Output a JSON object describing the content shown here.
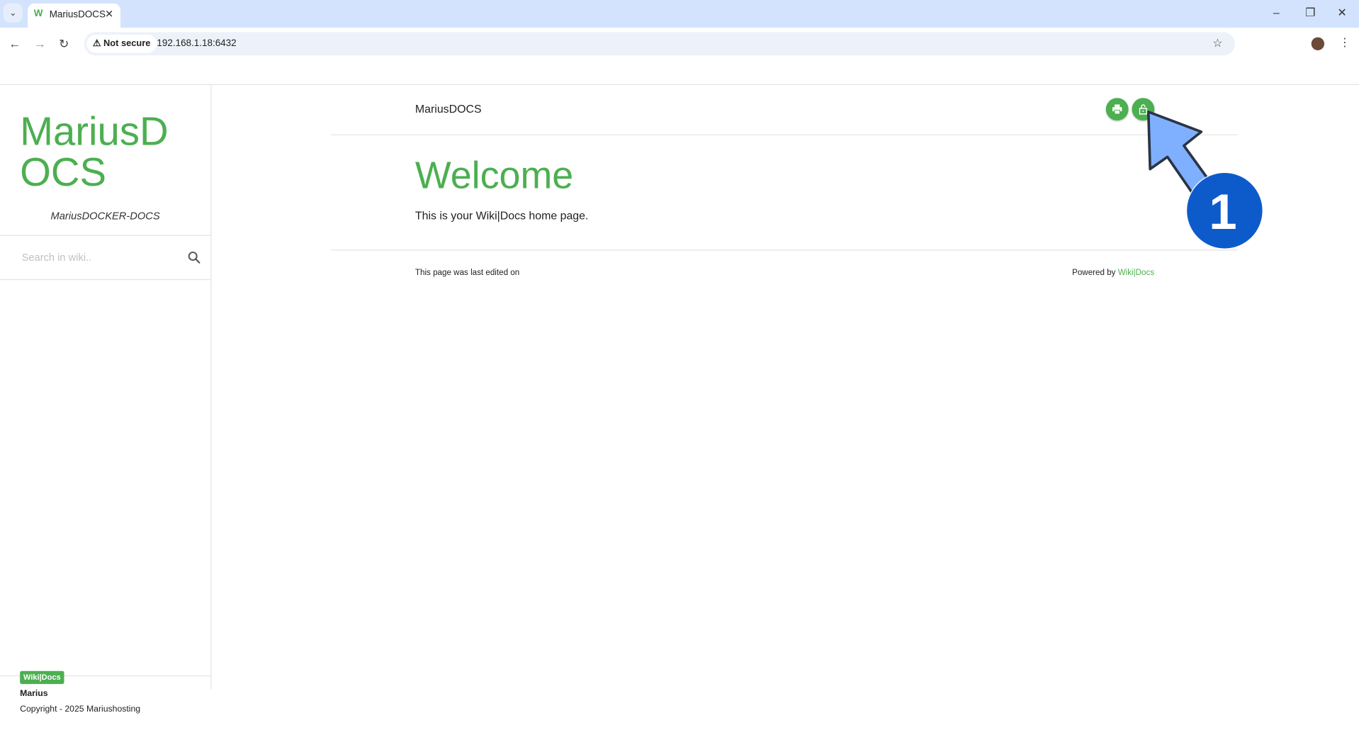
{
  "browser": {
    "tab_title": "MariusDOCS",
    "tab_favicon": "W",
    "security_label": "Not secure",
    "url": "192.168.1.18:6432"
  },
  "sidebar": {
    "brand": "MariusDOCS",
    "subtitle": "MariusDOCKER-DOCS",
    "search_placeholder": "Search in wiki..",
    "footer_badge": "Wiki|Docs",
    "footer_name": "Marius",
    "footer_copyright": "Copyright - 2025 Mariushosting"
  },
  "main": {
    "header_title": "MariusDOCS",
    "heading": "Welcome",
    "body": "This is your Wiki|Docs home page.",
    "last_edited": "This page was last edited on",
    "powered_by": "Powered by",
    "powered_link": "Wiki|Docs",
    "buttons": [
      {
        "icon": "print-icon"
      },
      {
        "icon": "unlock-icon"
      }
    ]
  },
  "annotation": {
    "step": "1",
    "arrow_color": "#7fb0ff",
    "circle_color": "#0d5bcb"
  },
  "colors": {
    "accent": "#4caf50"
  }
}
